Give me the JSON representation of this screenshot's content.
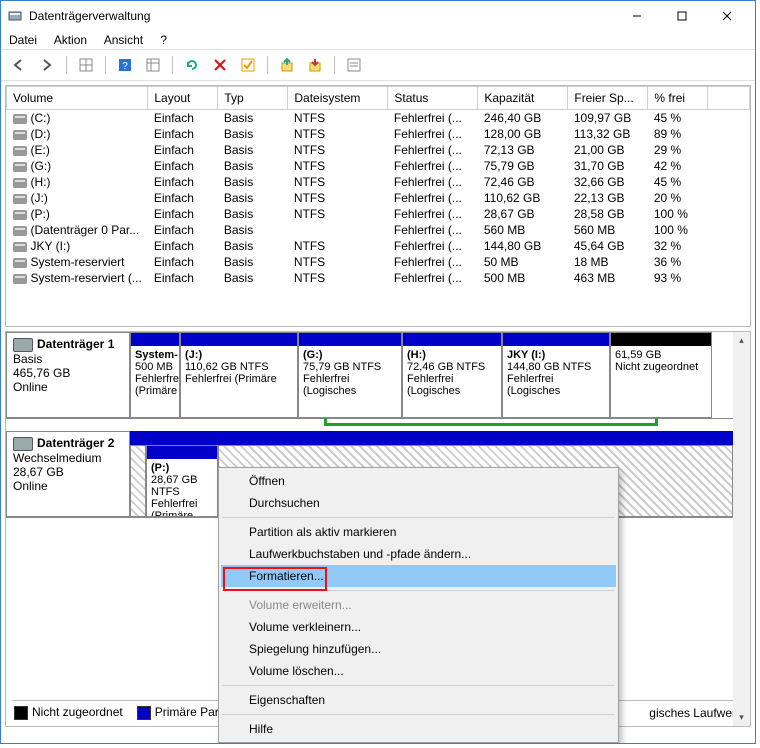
{
  "window": {
    "title": "Datenträgerverwaltung"
  },
  "menu": {
    "file": "Datei",
    "action": "Aktion",
    "view": "Ansicht",
    "help": "?"
  },
  "table": {
    "headers": {
      "volume": "Volume",
      "layout": "Layout",
      "typ": "Typ",
      "fs": "Dateisystem",
      "status": "Status",
      "cap": "Kapazität",
      "free": "Freier Sp...",
      "pct": "% frei"
    },
    "rows": [
      {
        "vol": "(C:)",
        "layout": "Einfach",
        "typ": "Basis",
        "fs": "NTFS",
        "status": "Fehlerfrei (...",
        "cap": "246,40 GB",
        "free": "109,97 GB",
        "pct": "45 %"
      },
      {
        "vol": "(D:)",
        "layout": "Einfach",
        "typ": "Basis",
        "fs": "NTFS",
        "status": "Fehlerfrei (...",
        "cap": "128,00 GB",
        "free": "113,32 GB",
        "pct": "89 %"
      },
      {
        "vol": "(E:)",
        "layout": "Einfach",
        "typ": "Basis",
        "fs": "NTFS",
        "status": "Fehlerfrei (...",
        "cap": "72,13 GB",
        "free": "21,00 GB",
        "pct": "29 %"
      },
      {
        "vol": "(G:)",
        "layout": "Einfach",
        "typ": "Basis",
        "fs": "NTFS",
        "status": "Fehlerfrei (...",
        "cap": "75,79 GB",
        "free": "31,70 GB",
        "pct": "42 %"
      },
      {
        "vol": "(H:)",
        "layout": "Einfach",
        "typ": "Basis",
        "fs": "NTFS",
        "status": "Fehlerfrei (...",
        "cap": "72,46 GB",
        "free": "32,66 GB",
        "pct": "45 %"
      },
      {
        "vol": "(J:)",
        "layout": "Einfach",
        "typ": "Basis",
        "fs": "NTFS",
        "status": "Fehlerfrei (...",
        "cap": "110,62 GB",
        "free": "22,13 GB",
        "pct": "20 %"
      },
      {
        "vol": "(P:)",
        "layout": "Einfach",
        "typ": "Basis",
        "fs": "NTFS",
        "status": "Fehlerfrei (...",
        "cap": "28,67 GB",
        "free": "28,58 GB",
        "pct": "100 %"
      },
      {
        "vol": "(Datenträger 0 Par...",
        "layout": "Einfach",
        "typ": "Basis",
        "fs": "",
        "status": "Fehlerfrei (...",
        "cap": "560 MB",
        "free": "560 MB",
        "pct": "100 %"
      },
      {
        "vol": "JKY  (I:)",
        "layout": "Einfach",
        "typ": "Basis",
        "fs": "NTFS",
        "status": "Fehlerfrei (...",
        "cap": "144,80 GB",
        "free": "45,64 GB",
        "pct": "32 %"
      },
      {
        "vol": "System-reserviert",
        "layout": "Einfach",
        "typ": "Basis",
        "fs": "NTFS",
        "status": "Fehlerfrei (...",
        "cap": "50 MB",
        "free": "18 MB",
        "pct": "36 %"
      },
      {
        "vol": "System-reserviert (...",
        "layout": "Einfach",
        "typ": "Basis",
        "fs": "NTFS",
        "status": "Fehlerfrei (...",
        "cap": "500 MB",
        "free": "463 MB",
        "pct": "93 %"
      }
    ]
  },
  "disks": {
    "d1": {
      "name": "Datenträger 1",
      "type": "Basis",
      "size": "465,76 GB",
      "status": "Online",
      "parts": [
        {
          "name": "System-",
          "l2": "500 MB",
          "l3": "Fehlerfrei (Primäre"
        },
        {
          "name": "(J:)",
          "l2": "110,62 GB NTFS",
          "l3": "Fehlerfrei (Primäre"
        },
        {
          "name": "(G:)",
          "l2": "75,79 GB NTFS",
          "l3": "Fehlerfrei (Logisches"
        },
        {
          "name": "(H:)",
          "l2": "72,46 GB NTFS",
          "l3": "Fehlerfrei (Logisches"
        },
        {
          "name": "JKY  (I:)",
          "l2": "144,80 GB NTFS",
          "l3": "Fehlerfrei (Logisches"
        },
        {
          "name": "",
          "l2": "61,59 GB",
          "l3": "Nicht zugeordnet"
        }
      ]
    },
    "d2": {
      "name": "Datenträger 2",
      "type": "Wechselmedium",
      "size": "28,67 GB",
      "status": "Online",
      "parts": [
        {
          "name": "(P:)",
          "l2": "28,67 GB NTFS",
          "l3": "Fehlerfrei (Primäre"
        }
      ]
    }
  },
  "legend": {
    "unalloc": "Nicht zugeordnet",
    "primary": "Primäre Partition",
    "logical": "gisches Laufwerk"
  },
  "context": {
    "open": "Öffnen",
    "browse": "Durchsuchen",
    "active": "Partition als aktiv markieren",
    "drive": "Laufwerkbuchstaben und -pfade ändern...",
    "format": "Formatieren...",
    "extend": "Volume erweitern...",
    "shrink": "Volume verkleinern...",
    "mirror": "Spiegelung hinzufügen...",
    "delete": "Volume löschen...",
    "props": "Eigenschaften",
    "help": "Hilfe"
  }
}
